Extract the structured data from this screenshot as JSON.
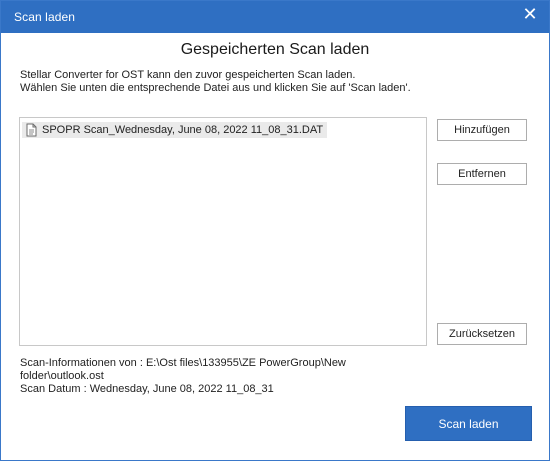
{
  "window": {
    "title": "Scan laden",
    "close_glyph": "✕"
  },
  "dialog": {
    "heading": "Gespeicherten Scan laden",
    "description_line1": "Stellar Converter for OST kann den zuvor gespeicherten Scan laden.",
    "description_line2": "Wählen Sie unten die entsprechende Datei aus und klicken Sie auf 'Scan laden'."
  },
  "file_list": {
    "items": [
      {
        "name": "SPOPR Scan_Wednesday, June 08, 2022 11_08_31.DAT",
        "icon": "document-icon",
        "selected": true
      }
    ]
  },
  "buttons": {
    "add": "Hinzufügen",
    "remove": "Entfernen",
    "reset": "Zurücksetzen",
    "load": "Scan laden"
  },
  "scan_info": {
    "line1": "Scan-Informationen von : E:\\Ost files\\133955\\ZE PowerGroup\\New",
    "line2": "folder\\outlook.ost",
    "line3": "Scan Datum : Wednesday, June 08, 2022 11_08_31"
  },
  "colors": {
    "accent": "#2f6fc2",
    "selection": "#eaeaea"
  }
}
